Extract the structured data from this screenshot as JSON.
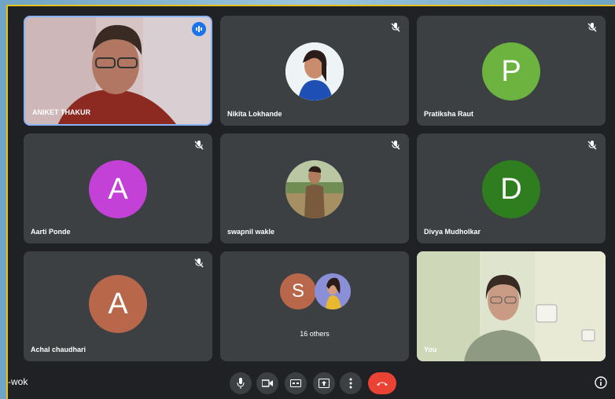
{
  "participants": [
    {
      "name": "ANIKET THAKUR",
      "kind": "video-speaking"
    },
    {
      "name": "Nikita Lokhande",
      "kind": "photo"
    },
    {
      "name": "Pratiksha Raut",
      "kind": "initial",
      "initial": "P",
      "color": "#6cb33f"
    },
    {
      "name": "Aarti Ponde",
      "kind": "initial",
      "initial": "A",
      "color": "#c341d6"
    },
    {
      "name": "swapnil wakle",
      "kind": "photo"
    },
    {
      "name": "Divya Mudholkar",
      "kind": "initial",
      "initial": "D",
      "color": "#2e7d1f"
    },
    {
      "name": "Achal chaudhari",
      "kind": "initial",
      "initial": "A",
      "color": "#b8674a"
    },
    {
      "name": "You",
      "kind": "video-self"
    }
  ],
  "others": {
    "label": "16 others",
    "initial": "S",
    "color": "#b8674a"
  },
  "bottom_bar": {
    "meeting_code": "-wok"
  },
  "colors": {
    "end_call": "#ea4335",
    "tile": "#3c4043",
    "background": "#202124"
  }
}
